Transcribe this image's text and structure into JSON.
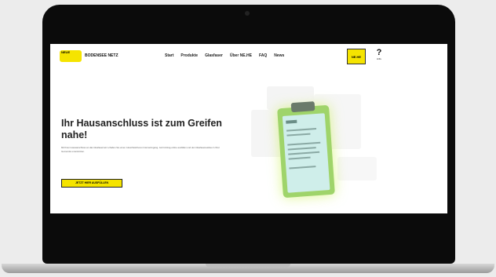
{
  "header": {
    "logo_text": "NEUE",
    "brand": "BODENSEE NETZ",
    "nav": [
      "Start",
      "Produkte",
      "Glasfaser",
      "Über NE.HE",
      "FAQ",
      "News"
    ],
    "badge": "NE.HE",
    "help_label": "Hilfe"
  },
  "hero": {
    "headline": "Ihr Hausanschluss ist zum Greifen nahe!",
    "body": "Mit Ihrem Hausanschluss an das Glasfasernetz erhalten Sie einen zukunftssicheren Internetzugang. Jetzt Antrag online ausfüllen und den Glasfaserausbau in Ihrer Gemeinde unterstützen.",
    "cta": "JETZT HIER AUSFÜLLEN"
  }
}
